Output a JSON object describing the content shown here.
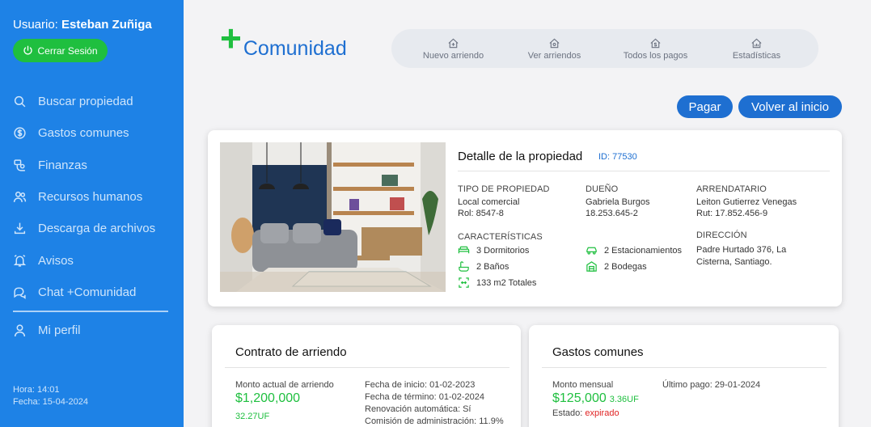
{
  "sidebar": {
    "user_prefix": "Usuario:",
    "user_name": "Esteban Zuñiga",
    "logout_label": "Cerrar Sesión",
    "items": [
      {
        "label": "Buscar propiedad",
        "icon": "search-icon"
      },
      {
        "label": "Gastos comunes",
        "icon": "dollar-circle-icon"
      },
      {
        "label": "Finanzas",
        "icon": "finance-icon"
      },
      {
        "label": "Recursos humanos",
        "icon": "people-icon"
      },
      {
        "label": "Descarga de archivos",
        "icon": "download-icon"
      },
      {
        "label": "Avisos",
        "icon": "alarm-icon"
      },
      {
        "label": "Chat +Comunidad",
        "icon": "chat-icon"
      }
    ],
    "profile_label": "Mi perfil",
    "time": "Hora: 14:01",
    "date": "Fecha: 15-04-2024"
  },
  "header": {
    "brand_plus": "+",
    "brand_name": "Comunidad",
    "nav": [
      {
        "label": "Nuevo arriendo",
        "icon": "house-add-icon"
      },
      {
        "label": "Ver arriendos",
        "icon": "house-view-icon"
      },
      {
        "label": "Todos los pagos",
        "icon": "house-dollar-icon"
      },
      {
        "label": "Estadísticas",
        "icon": "house-chart-icon"
      }
    ],
    "pay_label": "Pagar",
    "home_label": "Volver al inicio"
  },
  "property": {
    "title": "Detalle de la propiedad",
    "id": "ID: 77530",
    "type_label": "TIPO DE PROPIEDAD",
    "type_value": "Local comercial",
    "rol": "Rol: 8547-8",
    "owner_label": "DUEÑO",
    "owner_name": "Gabriela Burgos",
    "owner_rut": "18.253.645-2",
    "tenant_label": "ARRENDATARIO",
    "tenant_name": "Leiton Gutierrez Venegas",
    "tenant_rut": "Rut: 17.852.456-9",
    "features_label": "CARACTERÍSTICAS",
    "features": {
      "bedrooms": "3 Dormitorios",
      "bathrooms": "2 Baños",
      "area": "133 m2 Totales",
      "parking": "2 Estacionamientos",
      "storage": "2 Bodegas"
    },
    "address_label": "DIRECCIÓN",
    "address_line1": "Padre Hurtado 376, La",
    "address_line2": "Cisterna, Santiago."
  },
  "contract": {
    "title": "Contrato de arriendo",
    "amount_label": "Monto actual de arriendo",
    "amount": "$1,200,000",
    "uf": "32.27UF",
    "start": "Fecha de inicio: 01-02-2023",
    "end": "Fecha de término: 01-02-2024",
    "renewal": "Renovación automática: Sí",
    "commission": "Comisión de administración: 11.9%"
  },
  "common_expenses": {
    "title": "Gastos comunes",
    "monthly_label": "Monto mensual",
    "amount": "$125,000",
    "uf": "3.36UF",
    "last_payment": "Último pago: 29-01-2024",
    "status_label": "Estado:",
    "status_value": "expirado"
  },
  "colors": {
    "sidebar": "#1e82e6",
    "accent_green": "#1fbf3f",
    "primary_blue": "#1e6fd1",
    "status_red": "#e02424"
  }
}
